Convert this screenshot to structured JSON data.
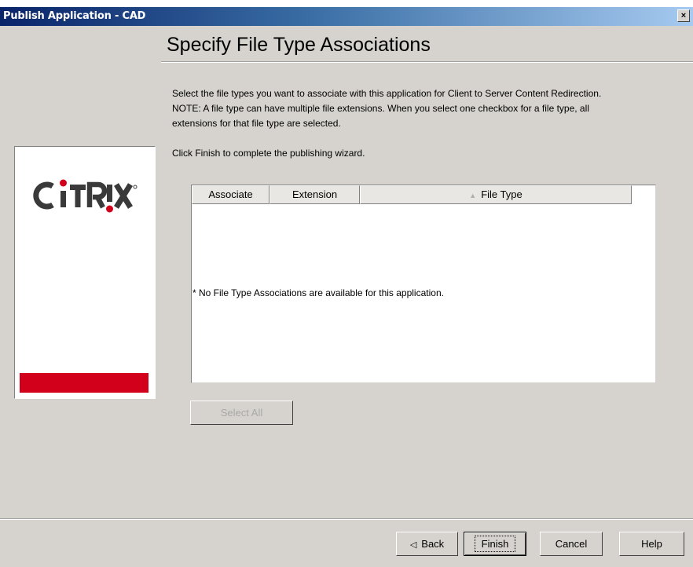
{
  "window": {
    "title": "Publish Application - CAD",
    "close_label": "×"
  },
  "header": {
    "title": "Specify File Type Associations"
  },
  "instructions": {
    "line1": "Select the file types you want to associate with this application for Client to Server Content Redirection.",
    "line2": "NOTE: A file type can have multiple file extensions. When you select one checkbox for a file type, all",
    "line3": "extensions for that file type are selected.",
    "finish_hint": "Click Finish to complete the publishing wizard."
  },
  "logo": {
    "text": "CiTRiX",
    "brand_color": "#d2001b"
  },
  "table": {
    "columns": [
      "Associate",
      "Extension",
      "File Type"
    ],
    "sort_icon": "sort-ascending-icon",
    "rows": [],
    "empty_message": "* No File Type Associations are available for this application."
  },
  "buttons": {
    "select_all": "Select All",
    "back": "Back",
    "finish": "Finish",
    "cancel": "Cancel",
    "help": "Help"
  }
}
